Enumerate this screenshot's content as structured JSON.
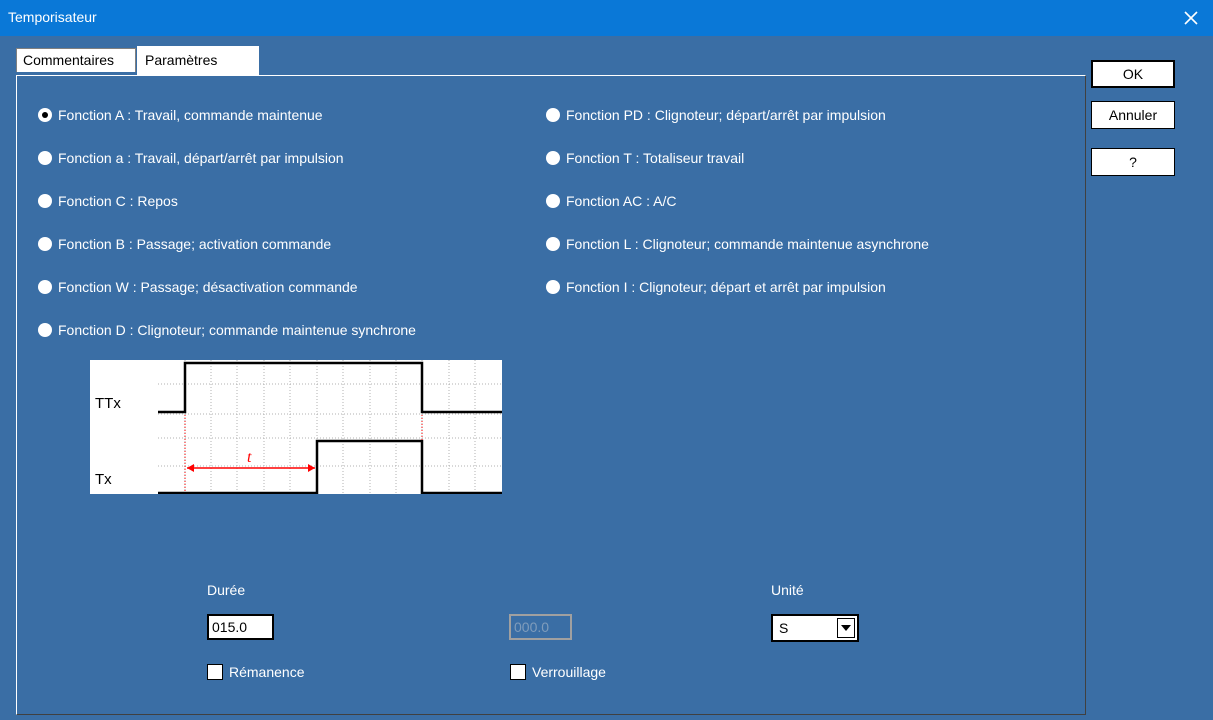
{
  "window": {
    "title": "Temporisateur"
  },
  "tabs": [
    {
      "label": "Commentaires",
      "active": false
    },
    {
      "label": "Paramètres",
      "active": true
    }
  ],
  "buttons": {
    "ok": "OK",
    "cancel": "Annuler",
    "help": "?"
  },
  "functions_left": [
    {
      "label": "Fonction A : Travail, commande maintenue",
      "selected": true
    },
    {
      "label": "Fonction a : Travail, départ/arrêt par impulsion",
      "selected": false
    },
    {
      "label": "Fonction C : Repos",
      "selected": false
    },
    {
      "label": "Fonction B : Passage; activation commande",
      "selected": false
    },
    {
      "label": "Fonction W : Passage; désactivation commande",
      "selected": false
    },
    {
      "label": "Fonction D : Clignoteur; commande maintenue synchrone",
      "selected": false
    }
  ],
  "functions_right": [
    {
      "label": "Fonction PD : Clignoteur; départ/arrêt par impulsion",
      "selected": false
    },
    {
      "label": "Fonction T : Totaliseur travail",
      "selected": false
    },
    {
      "label": "Fonction AC : A/C",
      "selected": false
    },
    {
      "label": "Fonction L : Clignoteur; commande maintenue asynchrone",
      "selected": false
    },
    {
      "label": "Fonction I : Clignoteur; départ et arrêt par impulsion",
      "selected": false
    }
  ],
  "diagram": {
    "signal_top": "TTx",
    "signal_bottom": "Tx",
    "delay_label": "t",
    "accent": "#ff0000"
  },
  "duration": {
    "label": "Durée",
    "value": "015.0",
    "disabled_value": "000.0"
  },
  "unit": {
    "label": "Unité",
    "value": "S"
  },
  "checkboxes": {
    "remanence": "Rémanence",
    "verrouillage": "Verrouillage"
  },
  "colors": {
    "background": "#3a6ea5",
    "titlebar": "#0a78d7"
  }
}
